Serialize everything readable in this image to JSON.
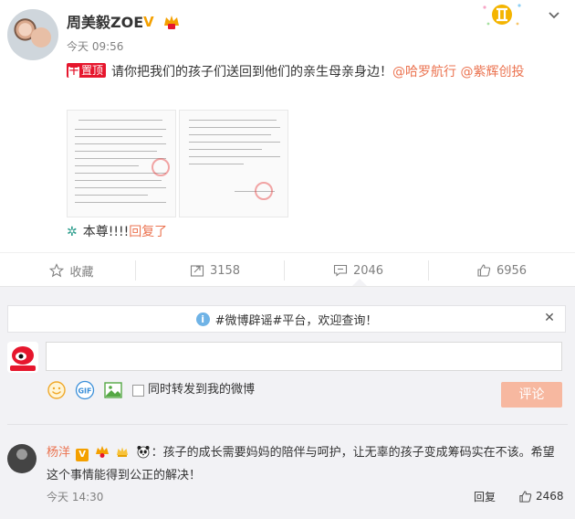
{
  "post": {
    "username": "周美毅ZOE",
    "timestamp": "今天 09:56",
    "pin_label": "置顶",
    "text_main": "请你把我们的孩子们送回到他们的亲生母亲身边！",
    "mentions": [
      "@哈罗航行",
      "@紫辉创投"
    ],
    "repost_prefix": "本尊!!!!",
    "repost_link": "回复了"
  },
  "actions": {
    "favorite_label": "收藏",
    "repost_count": "3158",
    "comment_count": "2046",
    "like_count": "6956"
  },
  "comments": {
    "rumor_notice": "#微博辟谣#平台，欢迎查询！",
    "sync_label": "同时转发到我的微博",
    "submit_label": "评论",
    "input_value": "",
    "items": [
      {
        "user": "杨洋",
        "content": "：孩子的成长需要妈妈的陪伴与呵护，让无辜的孩子变成筹码实在不该。希望这个事情能得到公正的解决！",
        "time": "今天 14:30",
        "reply_label": "回复",
        "likes": "2468"
      }
    ]
  },
  "colors": {
    "accent": "#eb7350",
    "pin_red": "#e6162d",
    "verified_gold": "#f4a000",
    "comment_btn": "#f7b8a0",
    "panel_bg": "#f2f2f5"
  },
  "icons": [
    "v-verified-icon",
    "vip-crown-icon",
    "gemini-zodiac-icon",
    "chevron-down-icon",
    "star-icon",
    "repost-icon",
    "comment-icon",
    "like-icon",
    "info-icon",
    "close-icon",
    "emoji-icon",
    "gif-icon",
    "image-icon"
  ]
}
